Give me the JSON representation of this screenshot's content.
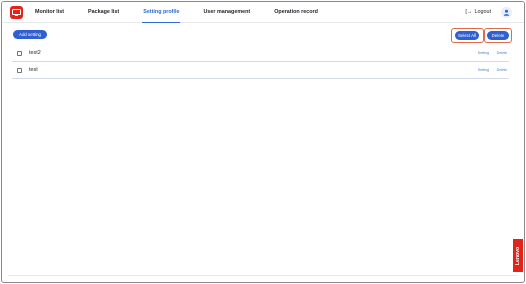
{
  "nav": {
    "items": [
      {
        "label": "Monitor list",
        "active": false
      },
      {
        "label": "Package list",
        "active": false
      },
      {
        "label": "Setting profile",
        "active": true
      },
      {
        "label": "User management",
        "active": false
      },
      {
        "label": "Operation record",
        "active": false
      }
    ],
    "logout_label": "Logout",
    "logout_icon": "logout-icon",
    "avatar_icon": "user-icon"
  },
  "toolbar": {
    "add_label": "Add setting",
    "select_all_label": "Select All",
    "delete_label": "Delete"
  },
  "rows": [
    {
      "name": "test2",
      "setting_label": "Setting",
      "delete_label": "Delete"
    },
    {
      "name": "test",
      "setting_label": "Setting",
      "delete_label": "Delete"
    }
  ],
  "brand": {
    "label": "Lenovo"
  },
  "colors": {
    "accent": "#2f5fd0",
    "brand": "#e2231a",
    "highlight": "#e06a4a"
  }
}
